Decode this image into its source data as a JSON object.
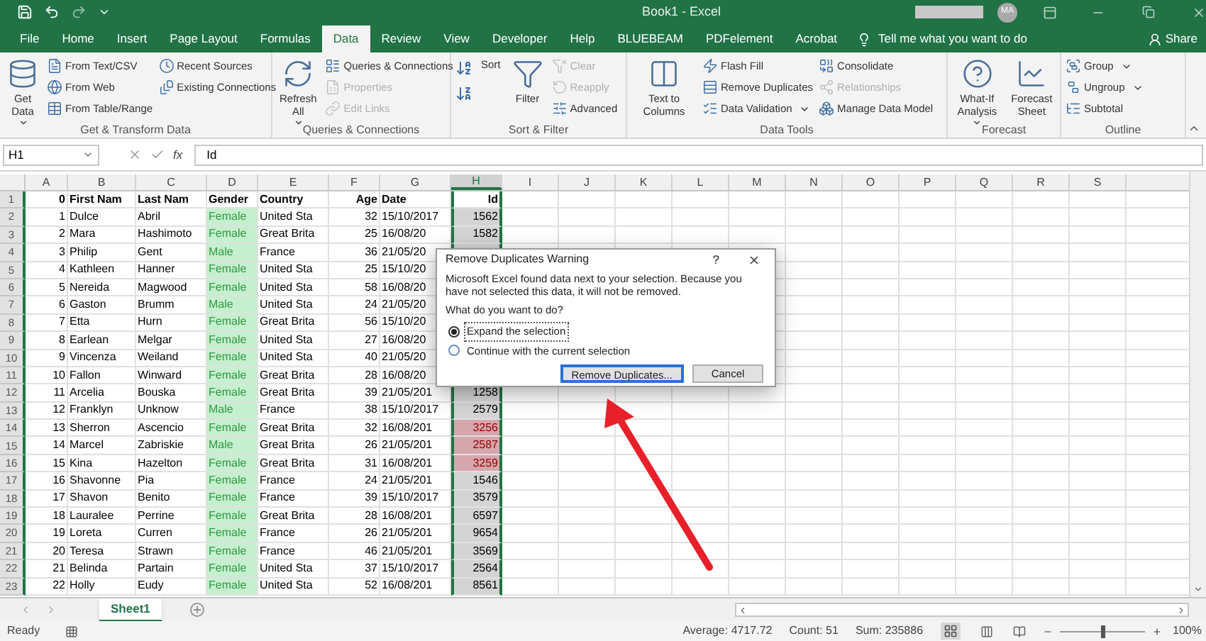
{
  "title_bar": {
    "title": "Book1 - Excel",
    "avatar": "MA"
  },
  "tabs": [
    {
      "label": "File",
      "selected": false
    },
    {
      "label": "Home",
      "selected": false
    },
    {
      "label": "Insert",
      "selected": false
    },
    {
      "label": "Page Layout",
      "selected": false
    },
    {
      "label": "Formulas",
      "selected": false
    },
    {
      "label": "Data",
      "selected": true
    },
    {
      "label": "Review",
      "selected": false
    },
    {
      "label": "View",
      "selected": false
    },
    {
      "label": "Developer",
      "selected": false
    },
    {
      "label": "Help",
      "selected": false
    },
    {
      "label": "BLUEBEAM",
      "selected": false
    },
    {
      "label": "PDFelement",
      "selected": false
    },
    {
      "label": "Acrobat",
      "selected": false
    }
  ],
  "tell_me": "Tell me what you want to do",
  "share": "Share",
  "ribbon_groups": [
    {
      "label": "Get & Transform Data",
      "items": [
        {
          "kind": "large",
          "label": "Get Data",
          "dropdown": true
        },
        {
          "kind": "stack",
          "buttons": [
            {
              "label": "From Text/CSV",
              "disabled": false,
              "dropdown": false
            },
            {
              "label": "From Web",
              "disabled": false,
              "dropdown": false
            },
            {
              "label": "From Table/Range",
              "disabled": false,
              "dropdown": false
            }
          ]
        },
        {
          "kind": "stack",
          "buttons": [
            {
              "label": "Recent Sources",
              "disabled": false,
              "dropdown": false
            },
            {
              "label": "Existing Connections",
              "disabled": false,
              "dropdown": false
            }
          ]
        }
      ]
    },
    {
      "label": "Queries & Connections",
      "items": [
        {
          "kind": "large",
          "label": "Refresh All",
          "dropdown": true
        },
        {
          "kind": "stack",
          "buttons": [
            {
              "label": "Queries & Connections",
              "disabled": false,
              "dropdown": false
            },
            {
              "label": "Properties",
              "disabled": true,
              "dropdown": false
            },
            {
              "label": "Edit Links",
              "disabled": true,
              "dropdown": false
            }
          ]
        }
      ]
    },
    {
      "label": "Sort & Filter",
      "items": [
        {
          "kind": "sort-pair"
        },
        {
          "kind": "large",
          "label": "Sort",
          "dropdown": false
        },
        {
          "kind": "large",
          "label": "Filter",
          "dropdown": false
        },
        {
          "kind": "stack",
          "buttons": [
            {
              "label": "Clear",
              "disabled": true,
              "dropdown": false
            },
            {
              "label": "Reapply",
              "disabled": true,
              "dropdown": false
            },
            {
              "label": "Advanced",
              "disabled": false,
              "dropdown": false
            }
          ]
        }
      ]
    },
    {
      "label": "Data Tools",
      "items": [
        {
          "kind": "large",
          "label": "Text to Columns",
          "dropdown": false
        },
        {
          "kind": "stack",
          "buttons": [
            {
              "label": "Flash Fill",
              "disabled": false,
              "dropdown": false
            },
            {
              "label": "Remove Duplicates",
              "disabled": false,
              "dropdown": false
            },
            {
              "label": "Data Validation",
              "disabled": false,
              "dropdown": true
            }
          ]
        },
        {
          "kind": "stack",
          "buttons": [
            {
              "label": "Consolidate",
              "disabled": false,
              "dropdown": false
            },
            {
              "label": "Relationships",
              "disabled": true,
              "dropdown": false
            },
            {
              "label": "Manage Data Model",
              "disabled": false,
              "dropdown": false
            }
          ]
        }
      ]
    },
    {
      "label": "Forecast",
      "items": [
        {
          "kind": "large",
          "label": "What-If Analysis",
          "dropdown": true
        },
        {
          "kind": "large",
          "label": "Forecast Sheet",
          "dropdown": false
        }
      ]
    },
    {
      "label": "Outline",
      "items": [
        {
          "kind": "stack",
          "buttons": [
            {
              "label": "Group",
              "disabled": false,
              "dropdown": true
            },
            {
              "label": "Ungroup",
              "disabled": false,
              "dropdown": true
            },
            {
              "label": "Subtotal",
              "disabled": false,
              "dropdown": false
            }
          ]
        }
      ]
    }
  ],
  "name_box": "H1",
  "function_label": "fx",
  "formula": "Id",
  "columns": [
    "A",
    "B",
    "C",
    "D",
    "E",
    "F",
    "G",
    "H",
    "I",
    "J",
    "K",
    "L",
    "M",
    "N",
    "O",
    "P",
    "Q",
    "R",
    "S"
  ],
  "rows": [
    {
      "number": "1",
      "header": true,
      "gender_highlighted": false,
      "id_duplicate": false,
      "cells": [
        "0",
        "First Nam",
        "Last Nam",
        "Gender",
        "Country",
        "Age",
        "Date",
        "Id"
      ]
    },
    {
      "number": "2",
      "header": false,
      "gender_highlighted": true,
      "id_duplicate": false,
      "cells": [
        "1",
        "Dulce",
        "Abril",
        "Female",
        "United Sta",
        "32",
        "15/10/2017",
        "1562"
      ]
    },
    {
      "number": "3",
      "header": false,
      "gender_highlighted": true,
      "id_duplicate": false,
      "cells": [
        "2",
        "Mara",
        "Hashimoto",
        "Female",
        "Great Brita",
        "25",
        "16/08/20",
        "1582"
      ]
    },
    {
      "number": "4",
      "header": false,
      "gender_highlighted": true,
      "id_duplicate": false,
      "cells": [
        "3",
        "Philip",
        "Gent",
        "Male",
        "France",
        "36",
        "21/05/20"
      ]
    },
    {
      "number": "5",
      "header": false,
      "gender_highlighted": true,
      "id_duplicate": false,
      "cells": [
        "4",
        "Kathleen",
        "Hanner",
        "Female",
        "United Sta",
        "25",
        "15/10/20"
      ]
    },
    {
      "number": "6",
      "header": false,
      "gender_highlighted": true,
      "id_duplicate": false,
      "cells": [
        "5",
        "Nereida",
        "Magwood",
        "Female",
        "United Sta",
        "58",
        "16/08/20"
      ]
    },
    {
      "number": "7",
      "header": false,
      "gender_highlighted": true,
      "id_duplicate": false,
      "cells": [
        "6",
        "Gaston",
        "Brumm",
        "Male",
        "United Sta",
        "24",
        "21/05/20"
      ]
    },
    {
      "number": "8",
      "header": false,
      "gender_highlighted": true,
      "id_duplicate": false,
      "cells": [
        "7",
        "Etta",
        "Hurn",
        "Female",
        "Great Brita",
        "56",
        "15/10/20"
      ]
    },
    {
      "number": "9",
      "header": false,
      "gender_highlighted": true,
      "id_duplicate": false,
      "cells": [
        "8",
        "Earlean",
        "Melgar",
        "Female",
        "United Sta",
        "27",
        "16/08/20"
      ]
    },
    {
      "number": "10",
      "header": false,
      "gender_highlighted": true,
      "id_duplicate": false,
      "cells": [
        "9",
        "Vincenza",
        "Weiland",
        "Female",
        "United Sta",
        "40",
        "21/05/20"
      ]
    },
    {
      "number": "11",
      "header": false,
      "gender_highlighted": true,
      "id_duplicate": false,
      "cells": [
        "10",
        "Fallon",
        "Winward",
        "Female",
        "Great Brita",
        "28",
        "16/08/20"
      ]
    },
    {
      "number": "12",
      "header": false,
      "gender_highlighted": true,
      "id_duplicate": false,
      "cells": [
        "11",
        "Arcelia",
        "Bouska",
        "Female",
        "Great Brita",
        "39",
        "21/05/201",
        "1258"
      ]
    },
    {
      "number": "13",
      "header": false,
      "gender_highlighted": true,
      "id_duplicate": false,
      "cells": [
        "12",
        "Franklyn",
        "Unknow",
        "Male",
        "France",
        "38",
        "15/10/2017",
        "2579"
      ]
    },
    {
      "number": "14",
      "header": false,
      "gender_highlighted": true,
      "id_duplicate": true,
      "cells": [
        "13",
        "Sherron",
        "Ascencio",
        "Female",
        "Great Brita",
        "32",
        "16/08/201",
        "3256"
      ]
    },
    {
      "number": "15",
      "header": false,
      "gender_highlighted": true,
      "id_duplicate": true,
      "cells": [
        "14",
        "Marcel",
        "Zabriskie",
        "Male",
        "Great Brita",
        "26",
        "21/05/201",
        "2587"
      ]
    },
    {
      "number": "16",
      "header": false,
      "gender_highlighted": true,
      "id_duplicate": true,
      "cells": [
        "15",
        "Kina",
        "Hazelton",
        "Female",
        "Great Brita",
        "31",
        "16/08/201",
        "3259"
      ]
    },
    {
      "number": "17",
      "header": false,
      "gender_highlighted": true,
      "id_duplicate": false,
      "cells": [
        "16",
        "Shavonne",
        "Pia",
        "Female",
        "France",
        "24",
        "21/05/201",
        "1546"
      ]
    },
    {
      "number": "18",
      "header": false,
      "gender_highlighted": true,
      "id_duplicate": false,
      "cells": [
        "17",
        "Shavon",
        "Benito",
        "Female",
        "France",
        "39",
        "15/10/2017",
        "3579"
      ]
    },
    {
      "number": "19",
      "header": false,
      "gender_highlighted": true,
      "id_duplicate": false,
      "cells": [
        "18",
        "Lauralee",
        "Perrine",
        "Female",
        "Great Brita",
        "28",
        "16/08/201",
        "6597"
      ]
    },
    {
      "number": "20",
      "header": false,
      "gender_highlighted": true,
      "id_duplicate": false,
      "cells": [
        "19",
        "Loreta",
        "Curren",
        "Female",
        "France",
        "26",
        "21/05/201",
        "9654"
      ]
    },
    {
      "number": "21",
      "header": false,
      "gender_highlighted": true,
      "id_duplicate": false,
      "cells": [
        "20",
        "Teresa",
        "Strawn",
        "Female",
        "France",
        "46",
        "21/05/201",
        "3569"
      ]
    },
    {
      "number": "22",
      "header": false,
      "gender_highlighted": true,
      "id_duplicate": false,
      "cells": [
        "21",
        "Belinda",
        "Partain",
        "Female",
        "United Sta",
        "37",
        "15/10/2017",
        "2564"
      ]
    },
    {
      "number": "23",
      "header": false,
      "gender_highlighted": true,
      "id_duplicate": false,
      "cells": [
        "22",
        "Holly",
        "Eudy",
        "Female",
        "United Sta",
        "52",
        "16/08/201",
        "8561"
      ]
    }
  ],
  "dialog": {
    "title": "Remove Duplicates Warning",
    "help": "?",
    "message": "Microsoft Excel found data next to your selection. Because you have not selected this data, it will not be removed.",
    "question": "What do you want to do?",
    "options": [
      {
        "label": "Expand the selection",
        "selected": true
      },
      {
        "label": "Continue with the current selection",
        "selected": false
      }
    ],
    "buttons": [
      {
        "label": "Remove Duplicates...",
        "default": true
      },
      {
        "label": "Cancel",
        "default": false
      }
    ]
  },
  "sheet_tabs": [
    {
      "label": "Sheet1",
      "selected": true
    }
  ],
  "status_bar": {
    "mode": "Ready",
    "average": "Average: 4717.72",
    "count": "Count: 51",
    "sum": "Sum: 235886",
    "zoom": "100%",
    "zoom_slider": {
      "level": 0.5
    }
  }
}
